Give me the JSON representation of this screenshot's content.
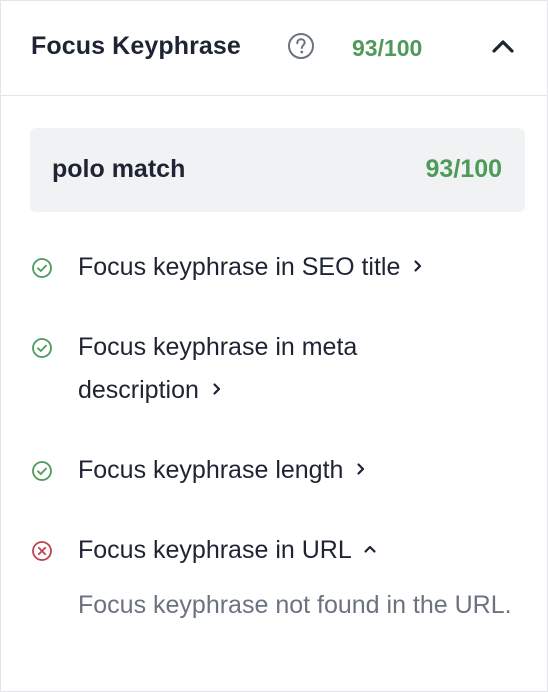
{
  "header": {
    "title": "Focus Keyphrase",
    "score": "93/100",
    "help_icon": "question-circle-icon",
    "collapse_icon": "chevron-up-icon"
  },
  "keyphrase": {
    "text": "polo match",
    "score": "93/100"
  },
  "results": [
    {
      "label": "Focus keyphrase in SEO title",
      "status": "good",
      "icon": "check-circle-icon",
      "chevron": "chevron-right-icon"
    },
    {
      "label": "Focus keyphrase in meta description",
      "status": "good",
      "icon": "check-circle-icon",
      "chevron": "chevron-right-icon"
    },
    {
      "label": "Focus keyphrase length",
      "status": "good",
      "icon": "check-circle-icon",
      "chevron": "chevron-right-icon"
    },
    {
      "label": "Focus keyphrase in URL",
      "status": "bad",
      "icon": "x-circle-icon",
      "chevron": "chevron-up-icon",
      "expanded": true,
      "detail": "Focus keyphrase not found in the URL."
    }
  ],
  "colors": {
    "good": "#4e9a59",
    "bad": "#c1424f",
    "text": "#1e2433",
    "muted": "#6b7280",
    "box_bg": "#f1f2f4",
    "border": "#e3e5e8"
  }
}
